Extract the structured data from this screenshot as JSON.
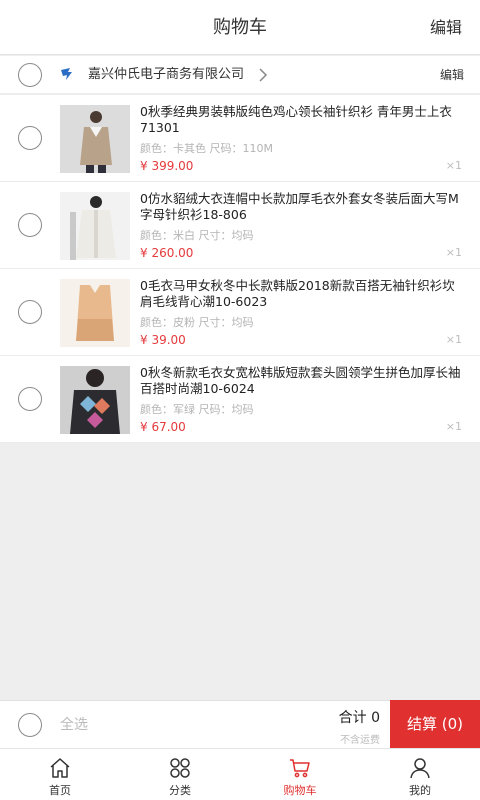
{
  "header": {
    "title": "购物车",
    "edit": "编辑"
  },
  "shop": {
    "name": "嘉兴仲氏电子商务有限公司",
    "edit": "编辑",
    "icon": "store-logo-icon"
  },
  "items": [
    {
      "name": "0秋季经典男装韩版纯色鸡心领长袖针织衫 青年男士上衣71301",
      "spec": "颜色：卡其色 尺码：110M",
      "price": "¥ 399.00",
      "qty": "×1"
    },
    {
      "name": "0仿水貂绒大衣连帽中长款加厚毛衣外套女冬装后面大写M字母针织衫18-806",
      "spec": "颜色：米白 尺寸：均码",
      "price": "¥ 260.00",
      "qty": "×1"
    },
    {
      "name": "0毛衣马甲女秋冬中长款韩版2018新款百搭无袖针织衫坎肩毛线背心潮10-6023",
      "spec": "颜色：皮粉 尺寸：均码",
      "price": "¥ 39.00",
      "qty": "×1"
    },
    {
      "name": "0秋冬新款毛衣女宽松韩版短款套头圆领学生拼色加厚长袖百搭时尚潮10-6024",
      "spec": "颜色：军绿 尺码：均码",
      "price": "¥ 67.00",
      "qty": "×1"
    }
  ],
  "bottom": {
    "select_all": "全选",
    "total": "合计 0",
    "freight": "不含运费",
    "checkout": "结算 (0)"
  },
  "tabs": [
    {
      "label": "首页",
      "icon": "home-icon"
    },
    {
      "label": "分类",
      "icon": "category-icon"
    },
    {
      "label": "购物车",
      "icon": "cart-icon"
    },
    {
      "label": "我的",
      "icon": "user-icon"
    }
  ],
  "colors": {
    "accent": "#e03030",
    "price": "#e4393c",
    "background": "#eeeeee"
  }
}
